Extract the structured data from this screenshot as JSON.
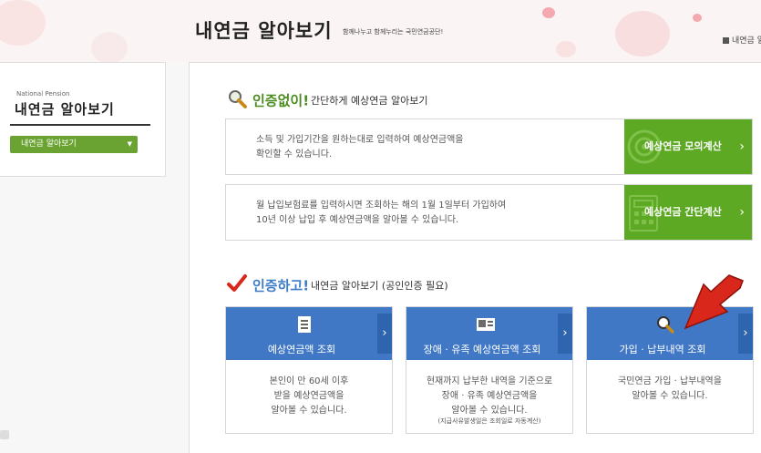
{
  "header": {
    "title": "내연금 알아보기",
    "subtitle": "함께나누고 함께누리는 국민연금공단!",
    "util_label": "내연금 알"
  },
  "left_nav": {
    "eyebrow": "National Pension",
    "title": "내연금 알아보기",
    "select_value": "내연금 알아보기"
  },
  "section_no_auth": {
    "emphasis": "인증없이!",
    "rest": "간단하게 예상연금 알아보기"
  },
  "calc_items": [
    {
      "desc_line1": "소득 및 가입기간을 원하는대로 입력하여 예상연금액을",
      "desc_line2": "확인할 수 있습니다.",
      "button": "예상연금 모의계산",
      "arrow": "›"
    },
    {
      "desc_line1": "월 납입보험료를 입력하시면 조회하는 해의 1월 1일부터 가입하여",
      "desc_line2": "10년 이상 납입 후 예상연금액을 알아볼 수 있습니다.",
      "button": "예상연금 간단계산",
      "arrow": "›"
    }
  ],
  "section_auth": {
    "emphasis": "인증하고!",
    "rest": "내연금 알아보기 (공인인증 필요)"
  },
  "cards": [
    {
      "title": "예상연금액 조회",
      "arrow": "›",
      "desc_line1": "본인이 만 60세 이후",
      "desc_line2": "받을 예상연금액을",
      "desc_line3": "알아볼 수 있습니다.",
      "note": ""
    },
    {
      "title": "장애 · 유족 예상연금액 조회",
      "arrow": "›",
      "desc_line1": "현재까지 납부한 내역을 기준으로",
      "desc_line2": "장애 · 유족 예상연금액을",
      "desc_line3": "알아볼 수 있습니다.",
      "note": "(지급사유발생일은 조회일로 자동계산)"
    },
    {
      "title": "가입 · 납부내역 조회",
      "arrow": "›",
      "desc_line1": "국민연금 가입 · 납부내역을",
      "desc_line2": "알아볼 수 있습니다.",
      "desc_line3": "",
      "note": ""
    }
  ],
  "icons": [
    "magnifier-icon",
    "target-icon",
    "calculator-icon",
    "check-icon",
    "document-icon",
    "id-card-icon",
    "search-icon",
    "red-arrow-icon"
  ],
  "colors": {
    "green": "#5da924",
    "blue": "#4078c6",
    "dark_blue": "#2f64ae",
    "red": "#d9271b"
  }
}
